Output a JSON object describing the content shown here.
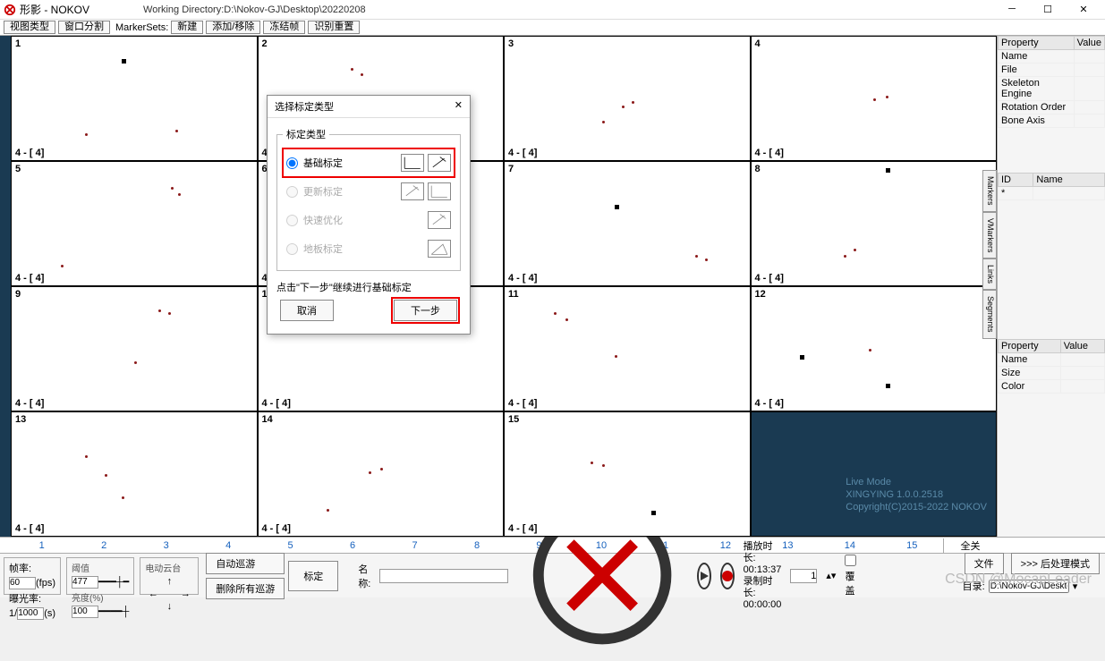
{
  "titlebar": {
    "app": "形影 - NOKOV",
    "workdir_label": "Working Directory:",
    "workdir_path": "D:\\Nokov-GJ\\Desktop\\20220208"
  },
  "toolbar": {
    "view_type": "视图类型",
    "window_split": "窗口分割",
    "markersets": "MarkerSets:",
    "new": "新建",
    "add_move": "添加/移除",
    "freeze": "冻结帧",
    "reset": "识别重置"
  },
  "cells": {
    "nums": [
      "1",
      "2",
      "3",
      "4",
      "5",
      "6",
      "7",
      "8",
      "9",
      "10",
      "11",
      "12",
      "13",
      "14",
      "15",
      ""
    ],
    "bot": "4 - [ 4]"
  },
  "livemode": {
    "line1": "Live Mode",
    "line2": "XINGYING 1.0.0.2518",
    "line3": "Copyright(C)2015-2022 NOKOV"
  },
  "right_props_top": {
    "h1": "Property",
    "h2": "Value",
    "rows": [
      "Name",
      "File",
      "Skeleton Engine",
      "Rotation Order",
      "Bone Axis"
    ]
  },
  "right_markers": {
    "h1": "ID",
    "h2": "Name",
    "row": "*"
  },
  "right_props_bot": {
    "h1": "Property",
    "h2": "Value",
    "rows": [
      "Name",
      "Size",
      "Color"
    ]
  },
  "side_tabs": [
    "Markers",
    "VMarkers",
    "Links",
    "Segments"
  ],
  "ruler": {
    "ticks": [
      "1",
      "2",
      "3",
      "4",
      "5",
      "6",
      "7",
      "8",
      "9",
      "10",
      "11",
      "12",
      "13",
      "14",
      "15"
    ],
    "end": "全关"
  },
  "bottom": {
    "frame_rate": {
      "label": "帧率:",
      "val": "60",
      "unit": "(fps)"
    },
    "exposure": {
      "label": "曝光率:",
      "val1": "1/",
      "val2": "1000",
      "unit": "(s)"
    },
    "threshold": {
      "label": "阈值",
      "val": "477"
    },
    "brightness": {
      "label": "亮度(%)",
      "val": "100"
    },
    "ptz": "电动云台",
    "auto_loop": "自动巡游",
    "del_loop": "删除所有巡游",
    "calibrate": "标定",
    "name_label": "名称:",
    "frame_field": "1",
    "overlay": "覆盖",
    "play_dur_label": "播放时长:",
    "play_dur": "00:13:37",
    "rec_dur_label": "录制时长:",
    "rec_dur": "00:00:00"
  },
  "bot_right": {
    "file": "文件",
    "postproc": ">>> 后处理模式",
    "dir_label": "目录:",
    "dir_value": "D:\\Nokov-GJ\\Desktop\\"
  },
  "dialog": {
    "title": "选择标定类型",
    "group": "标定类型",
    "opt1": "基础标定",
    "opt2": "更新标定",
    "opt3": "快速优化",
    "opt4": "地板标定",
    "hint": "点击\"下一步\"继续进行基础标定",
    "cancel": "取消",
    "next": "下一步"
  },
  "watermark": "CSDN @MocapLeader"
}
